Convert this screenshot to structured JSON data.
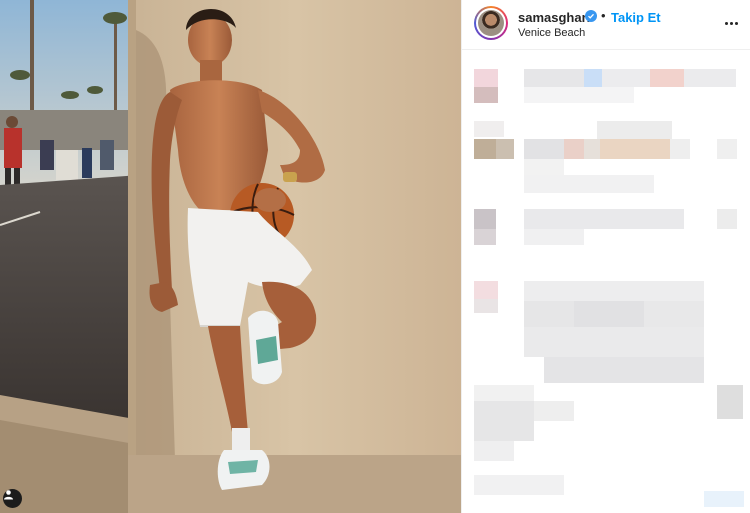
{
  "post": {
    "username": "samasghari",
    "follow_label": "Takip Et",
    "separator": "•",
    "location": "Venice Beach"
  },
  "icons": {
    "verified": "verified-badge-icon",
    "more": "more-options-icon",
    "tag": "user-tag-icon"
  },
  "colors": {
    "accent": "#0095f6",
    "verified": "#3897f0",
    "text": "#262626"
  }
}
